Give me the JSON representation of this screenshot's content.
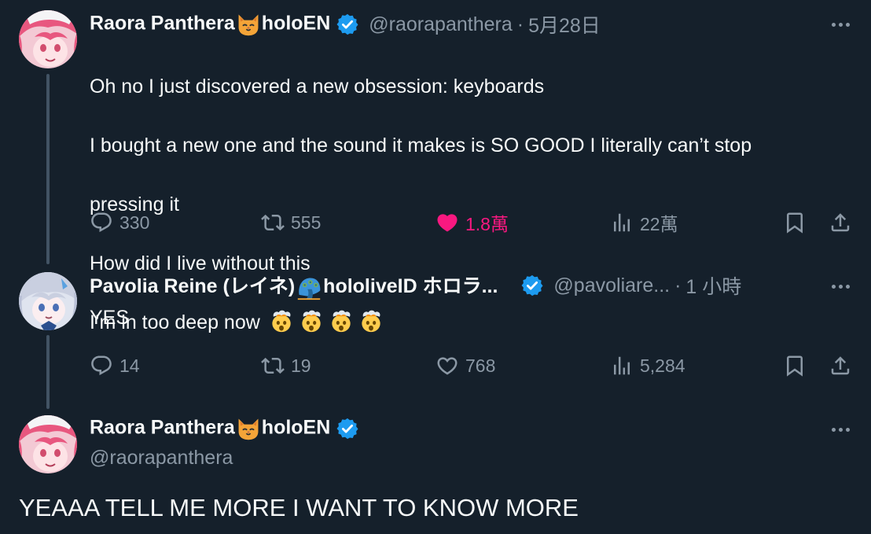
{
  "tweets": [
    {
      "display_name_before": "Raora Panthera",
      "display_name_after": "holoEN",
      "handle": "@raorapanthera",
      "separator": "·",
      "time": "5月28日",
      "text_lines": [
        "Oh no I just discovered a new obsession: keyboards",
        "I bought a new one and the sound it makes is SO GOOD I literally can’t stop",
        "pressing it",
        "How did I live without this"
      ],
      "last_line_text": "I’m in too deep now",
      "replies": "330",
      "retweets": "555",
      "likes": "1.8萬",
      "views": "22萬"
    },
    {
      "display_name_before": "Pavolia Reine (レイネ)",
      "display_name_after": "hololiveID ホロラ...",
      "handle": "@pavoliare...",
      "separator": "·",
      "time": "1 小時",
      "text": "YES",
      "replies": "14",
      "retweets": "19",
      "likes": "768",
      "views": "5,284"
    },
    {
      "display_name_before": "Raora Panthera",
      "display_name_after": "holoEN",
      "handle": "@raorapanthera",
      "text": "YEAAA TELL ME MORE I WANT TO KNOW MORE"
    }
  ],
  "colors": {
    "background": "#15202b",
    "text": "#f7f9f9",
    "muted": "#8b98a5",
    "verified": "#1d9bf0",
    "like": "#f91880",
    "thread_line": "#425364"
  },
  "icons": [
    "reply-icon",
    "retweet-icon",
    "like-icon",
    "views-icon",
    "bookmark-icon",
    "share-icon",
    "more-icon",
    "verified-icon"
  ]
}
